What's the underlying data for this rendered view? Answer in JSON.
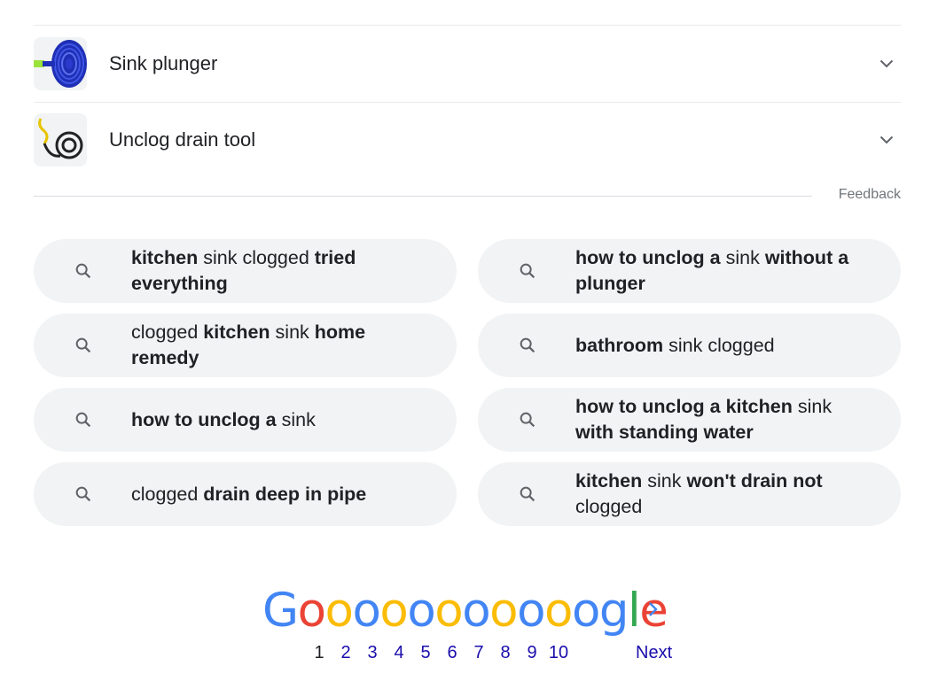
{
  "accordion": [
    {
      "label": "Sink plunger",
      "icon": "plunger-thumbnail"
    },
    {
      "label": "Unclog drain tool",
      "icon": "drain-snake-thumbnail"
    }
  ],
  "feedback_label": "Feedback",
  "related_searches": [
    {
      "parts": [
        [
          "b",
          "kitchen"
        ],
        [
          "n",
          " sink clogged "
        ],
        [
          "b",
          "tried everything"
        ]
      ]
    },
    {
      "parts": [
        [
          "b",
          "how to unclog a"
        ],
        [
          "n",
          " sink "
        ],
        [
          "b",
          "without a plunger"
        ]
      ]
    },
    {
      "parts": [
        [
          "n",
          "clogged "
        ],
        [
          "b",
          "kitchen"
        ],
        [
          "n",
          " sink "
        ],
        [
          "b",
          "home remedy"
        ]
      ]
    },
    {
      "parts": [
        [
          "b",
          "bathroom"
        ],
        [
          "n",
          " sink clogged"
        ]
      ]
    },
    {
      "parts": [
        [
          "b",
          "how to unclog a"
        ],
        [
          "n",
          " sink"
        ]
      ]
    },
    {
      "parts": [
        [
          "b",
          "how to unclog a kitchen"
        ],
        [
          "n",
          " sink "
        ],
        [
          "b",
          "with standing water"
        ]
      ]
    },
    {
      "parts": [
        [
          "n",
          "clogged "
        ],
        [
          "b",
          "drain deep in pipe"
        ]
      ]
    },
    {
      "parts": [
        [
          "b",
          "kitchen"
        ],
        [
          "n",
          " sink "
        ],
        [
          "b",
          "won't drain not"
        ],
        [
          "n",
          " clogged"
        ]
      ]
    }
  ],
  "pagination": {
    "logo_letters": [
      "G",
      "o",
      "o",
      "o",
      "o",
      "o",
      "o",
      "o",
      "o",
      "o",
      "o",
      "o",
      "g",
      "l",
      "e"
    ],
    "logo_colors": [
      "#4285f4",
      "#ea4335",
      "#fbbc05",
      "#4285f4",
      "#fbbc05",
      "#4285f4",
      "#fbbc05",
      "#4285f4",
      "#fbbc05",
      "#4285f4",
      "#fbbc05",
      "#4285f4",
      "#4285f4",
      "#34a853",
      "#ea4335"
    ],
    "pages": [
      "1",
      "2",
      "3",
      "4",
      "5",
      "6",
      "7",
      "8",
      "9",
      "10"
    ],
    "current_page": "1",
    "next_label": "Next"
  }
}
